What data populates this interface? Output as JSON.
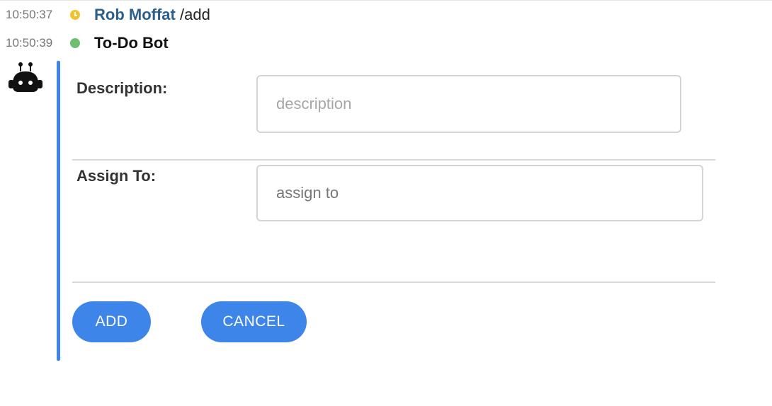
{
  "messages": [
    {
      "time": "10:50:37",
      "status": "pending",
      "sender": "Rob Moffat",
      "text": "/add"
    },
    {
      "time": "10:50:39",
      "status": "online",
      "sender": "To-Do Bot",
      "text": ""
    }
  ],
  "bot_avatar_icon": "robot-icon",
  "colors": {
    "accent": "#3d85e8",
    "user_name": "#2d5f8b",
    "status_pending": "#f2c230",
    "status_online": "#6fbf73"
  },
  "form": {
    "fields": [
      {
        "label": "Description:",
        "placeholder": "description",
        "value": ""
      },
      {
        "label": "Assign To:",
        "placeholder": "assign to",
        "value": ""
      }
    ],
    "buttons": {
      "add_label": "ADD",
      "cancel_label": "CANCEL"
    }
  }
}
